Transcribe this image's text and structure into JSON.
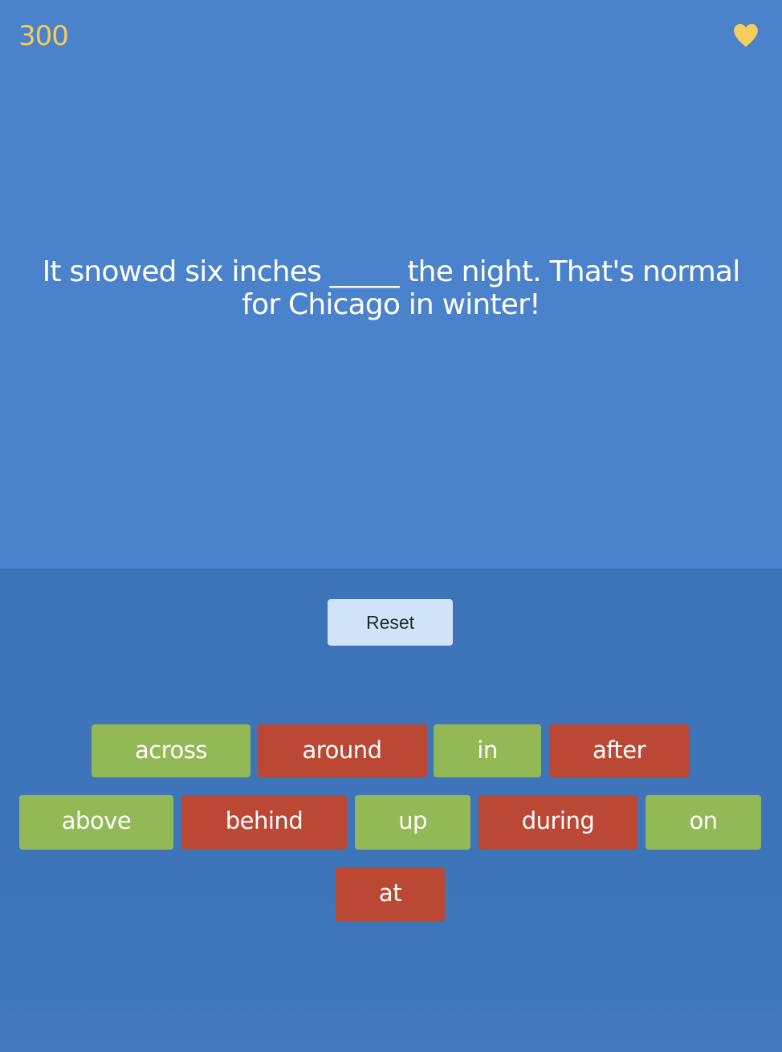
{
  "score": "300",
  "question": "It snowed six inches _____ the night. That's normal for Chicago in winter!",
  "reset_label": "Reset",
  "options": [
    "across",
    "around",
    "in",
    "after",
    "above",
    "behind",
    "up",
    "during",
    "on",
    "at"
  ],
  "colors": {
    "background_top": "#4a83cb",
    "background_bottom": "#3d73b9",
    "score": "#f5cd5b",
    "heart": "#f5cd5b",
    "reset_button": "#d1e3f6",
    "option_green": "#92b955",
    "option_red": "#bb4834"
  },
  "icons": {
    "lives": "heart-icon"
  }
}
